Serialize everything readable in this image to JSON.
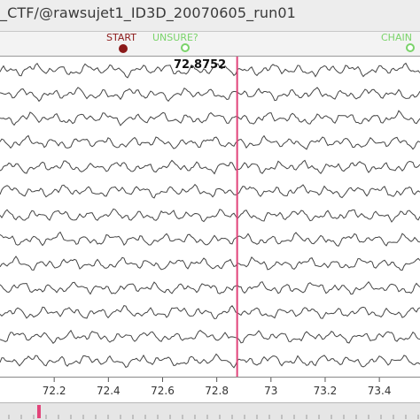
{
  "window": {
    "title": "_CTF/@rawsujet1_ID3D_20070605_run01"
  },
  "markers": [
    {
      "label": "START",
      "color": "#8b1a1a"
    },
    {
      "label": "UNSURE?",
      "color": "#7ad36a"
    },
    {
      "label": "CHAIN",
      "color": "#7ad36a"
    }
  ],
  "cursor": {
    "time_label": "72.8752",
    "time": 72.8752,
    "color": "#e2447a"
  },
  "plot": {
    "channel_count": 13,
    "trace_color": "#444444",
    "xlim": [
      72.0,
      73.55
    ]
  },
  "axis": {
    "ticks": [
      "72.2",
      "72.4",
      "72.6",
      "72.8",
      "73",
      "73.2",
      "73.4"
    ],
    "tick_values": [
      72.2,
      72.4,
      72.6,
      72.8,
      73.0,
      73.2,
      73.4
    ]
  },
  "timeline": {
    "position_color": "#e2447a"
  }
}
